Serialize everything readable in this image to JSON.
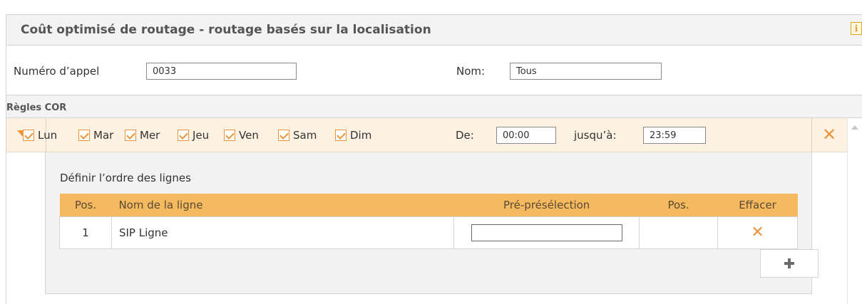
{
  "panel": {
    "title": "Coût optimisé de routage - routage basés sur la localisation",
    "info_icon": "info-icon"
  },
  "form": {
    "call_number_label": "Numéro d’appel",
    "call_number_value": "0033",
    "name_label": "Nom:",
    "name_value": "Tous"
  },
  "rules": {
    "header": "Règles COR",
    "days": [
      {
        "label": "Lun",
        "checked": true
      },
      {
        "label": "Mar",
        "checked": true
      },
      {
        "label": "Mer",
        "checked": true
      },
      {
        "label": "Jeu",
        "checked": true
      },
      {
        "label": "Ven",
        "checked": true
      },
      {
        "label": "Sam",
        "checked": true
      },
      {
        "label": "Dim",
        "checked": true
      }
    ],
    "from_label": "De:",
    "from_value": "00:00",
    "to_label": "jusqu’à:",
    "to_value": "23:59",
    "delete_glyph": "✕"
  },
  "lines_section": {
    "label": "Définir l’ordre des lignes",
    "columns": [
      "Pos.",
      "Nom de la ligne",
      "Pré-présélection",
      "Pos.",
      "Effacer"
    ],
    "rows": [
      {
        "pos": "1",
        "name": "SIP Ligne",
        "preselection": "",
        "pos2": "",
        "delete_glyph": "✕"
      }
    ]
  },
  "colors": {
    "accent": "#e8953c",
    "table_header": "#f5b95f",
    "rule_row_bg": "#fdf1e2"
  }
}
